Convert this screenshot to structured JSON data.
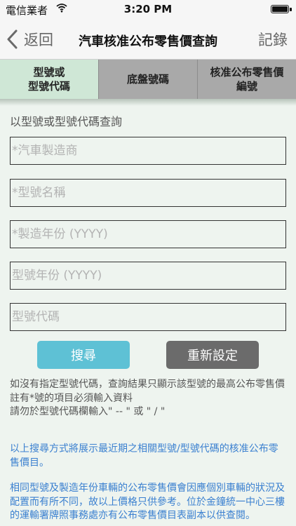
{
  "status_bar": {
    "carrier": "電信業者",
    "time": "3:20 PM"
  },
  "nav": {
    "back_label": "返回",
    "title": "汽車核准公布零售價查詢",
    "right_label": "記錄"
  },
  "tabs": [
    {
      "label": "型號或\n型號代碼",
      "active": true
    },
    {
      "label": "底盤號碼",
      "active": false
    },
    {
      "label": "核准公布零售價\n編號",
      "active": false
    }
  ],
  "form": {
    "heading": "以型號或型號代碼查詢",
    "fields": [
      {
        "placeholder": "*汽車製造商",
        "value": ""
      },
      {
        "placeholder": "*型號名稱",
        "value": ""
      },
      {
        "placeholder": "*製造年份 (YYYY)",
        "value": ""
      },
      {
        "placeholder": "型號年份 (YYYY)",
        "value": ""
      },
      {
        "placeholder": "型號代碼",
        "value": ""
      }
    ],
    "search_label": "搜尋",
    "reset_label": "重新設定"
  },
  "notes": {
    "grey": "如沒有指定型號代碼，查詢結果只顯示該型號的最高公布零售價\n註有*號的項目必須輸入資料\n請勿於型號代碼欄輸入\" -- \" 或 \" / \"",
    "blue1": "以上搜尋方式將展示最近期之相關型號/型號代碼的核准公布零售價目。",
    "blue2": "相同型號及製造年份車輛的公布零售價會因應個別車輛的狀況及配置而有所不同，故以上價格只供參考。位於金鐘統一中心三樓的運輸署牌照事務處亦有公布零售價目表副本以供查閱。"
  },
  "colors": {
    "background": "#eef4ef",
    "active_tab": "#cfe7d6",
    "inactive_tab": "#a9a9a9",
    "search_button": "#5ec1d5",
    "reset_button": "#6b6b6b",
    "note_blue": "#3b80d0"
  },
  "icons": {
    "back": "chevron-left-icon",
    "wifi": "wifi-icon",
    "battery": "battery-icon"
  }
}
